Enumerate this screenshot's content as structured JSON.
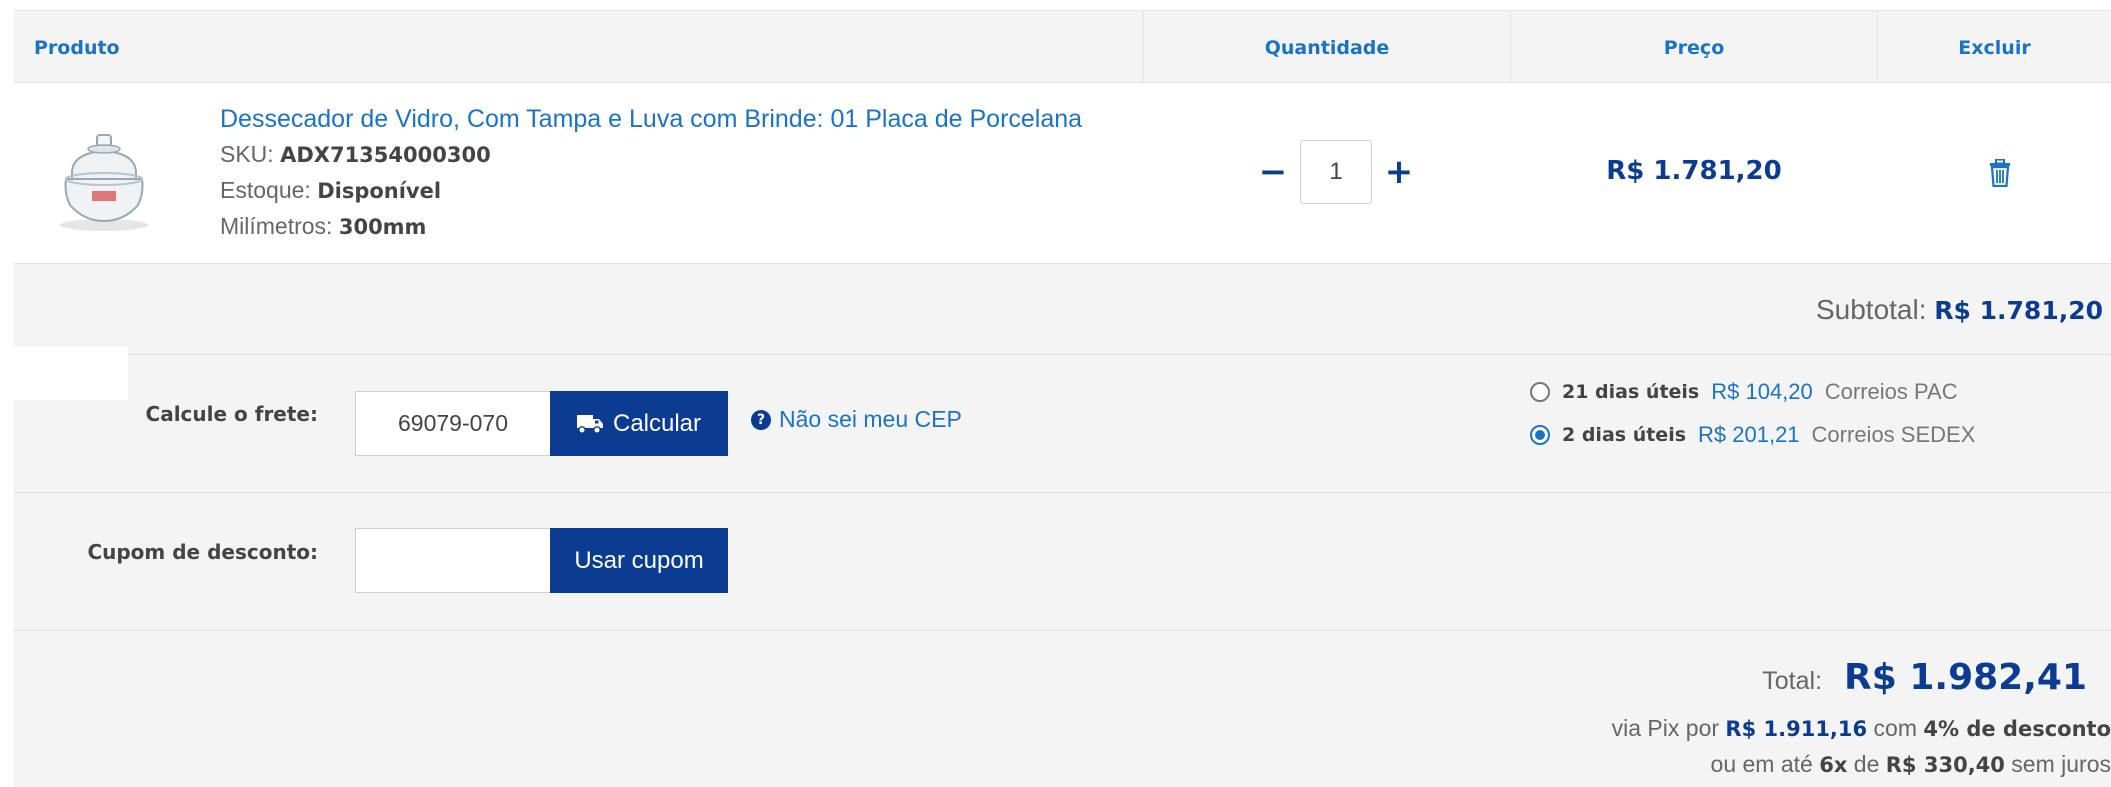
{
  "table": {
    "headers": {
      "produto": "Produto",
      "quantidade": "Quantidade",
      "preco": "Preço",
      "excluir": "Excluir"
    }
  },
  "item": {
    "name": "Dessecador de Vidro, Com Tampa e Luva com Brinde: 01 Placa de Porcelana",
    "sku_label": "SKU:",
    "sku": "ADX71354000300",
    "stock_label": "Estoque:",
    "stock": "Disponível",
    "mm_label": "Milímetros:",
    "mm": "300mm",
    "quantity": "1",
    "minus": "−",
    "plus": "+",
    "price": "R$ 1.781,20",
    "icons": {
      "thumbnail": "desiccator-image",
      "delete": "trash-icon"
    }
  },
  "subtotal": {
    "label": "Subtotal:",
    "value": "R$ 1.781,20"
  },
  "frete": {
    "label": "Calcule o frete:",
    "cep": "69079-070",
    "button": "Calcular",
    "help": "Não sei meu CEP",
    "options": [
      {
        "days": "21 dias úteis",
        "price": "R$ 104,20",
        "name": "Correios PAC",
        "selected": false
      },
      {
        "days": "2 dias úteis",
        "price": "R$ 201,21",
        "name": "Correios SEDEX",
        "selected": true
      }
    ]
  },
  "cupom": {
    "label": "Cupom de desconto:",
    "value": "",
    "button": "Usar cupom"
  },
  "total": {
    "label": "Total:",
    "value": "R$ 1.982,41",
    "pix_prefix": "via Pix por",
    "pix_value": "R$ 1.911,16",
    "pix_mid": "com",
    "pix_discount": "4% de desconto",
    "parc_prefix": "ou em até",
    "parc_times": "6x",
    "parc_mid": "de",
    "parc_value": "R$ 330,40",
    "parc_suffix": "sem juros"
  },
  "colors": {
    "primary": "#0b3c91",
    "link": "#1a73c7",
    "panel": "#f4f4f4"
  }
}
